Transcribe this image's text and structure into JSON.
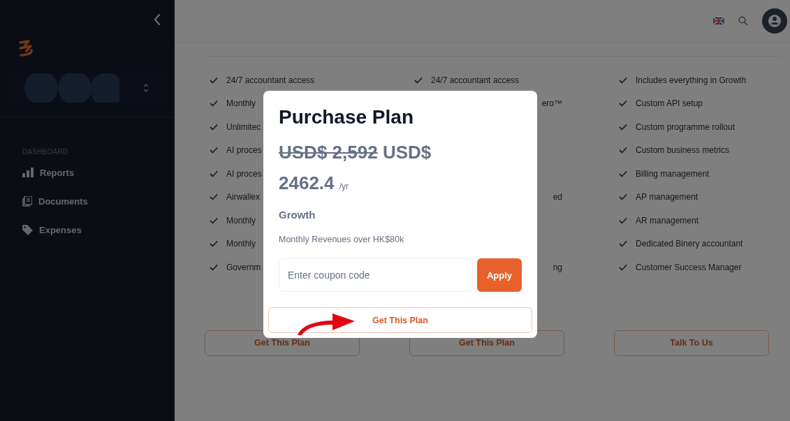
{
  "sidebar": {
    "section_label": "DASHBOARD",
    "items": [
      {
        "label": "Reports",
        "kind": "reports"
      },
      {
        "label": "Documents",
        "kind": "documents"
      },
      {
        "label": "Expenses",
        "kind": "expenses"
      }
    ]
  },
  "plans": [
    {
      "features": [
        {
          "text": "24/7 accountant access"
        },
        {
          "text": "Monthly"
        },
        {
          "text": "Unlimitec"
        },
        {
          "text": "AI proces"
        },
        {
          "text": "AI proces"
        },
        {
          "text": "Airwallex"
        },
        {
          "text": "Monthly"
        },
        {
          "text": "Monthly"
        },
        {
          "text": "Governm"
        }
      ],
      "button": "Get This Plan"
    },
    {
      "features": [
        {
          "text": "24/7 accountant access"
        },
        {
          "text": "ero™",
          "kind": "fragment"
        },
        {
          "text": "ed",
          "kind": "fragment"
        },
        {
          "text": "ng",
          "kind": "fragment"
        }
      ],
      "button": "Get This Plan"
    },
    {
      "features": [
        {
          "text": "Includes everything in Growth"
        },
        {
          "text": "Custom API setup"
        },
        {
          "text": "Custom programme rollout"
        },
        {
          "text": "Custom business metrics"
        },
        {
          "text": "Billing management"
        },
        {
          "text": "AP management"
        },
        {
          "text": "AR management"
        },
        {
          "text": "Dedicated Binery accountant"
        },
        {
          "text": "Customer Success Manager"
        }
      ],
      "button": "Talk To Us"
    }
  ],
  "modal": {
    "title": "Purchase Plan",
    "old_price": "USD$ 2,592",
    "price": "USD$ 2462.4",
    "period": "/yr",
    "plan_name": "Growth",
    "description": "Monthly Revenues over HK$80k",
    "coupon": {
      "placeholder": "Enter coupon code"
    },
    "apply_button": "Apply",
    "submit_button": "Get This Plan"
  }
}
